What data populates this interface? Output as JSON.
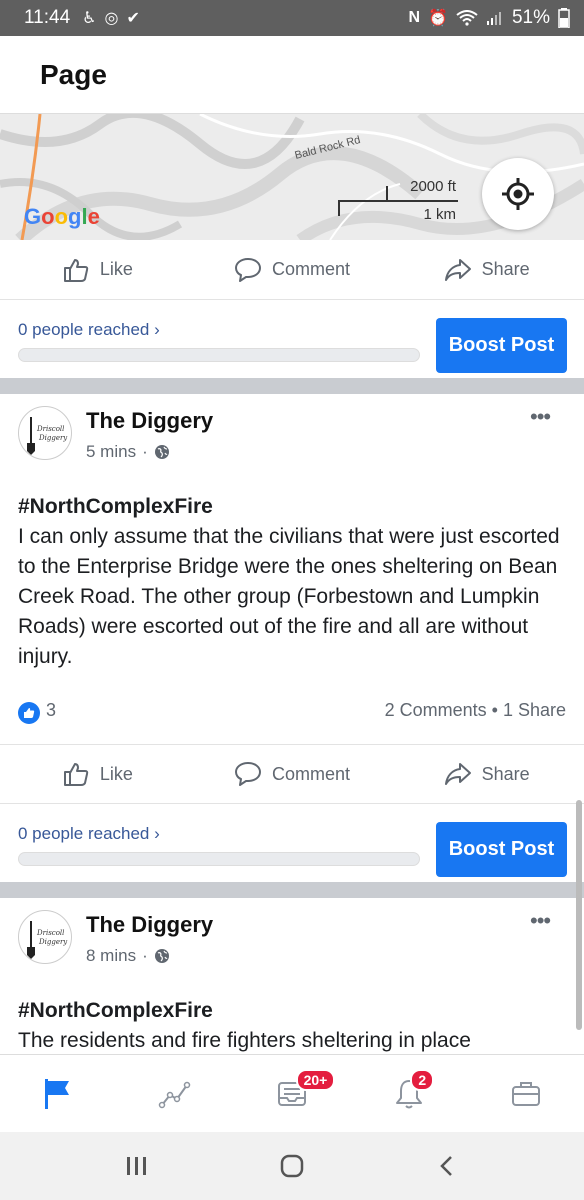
{
  "status_bar": {
    "time": "11:44",
    "battery": "51%"
  },
  "header": {
    "title": "Page"
  },
  "map": {
    "road_label": "Bald Rock Rd",
    "provider": "Google",
    "scale_ft": "2000 ft",
    "scale_km": "1 km"
  },
  "actions": {
    "like": "Like",
    "comment": "Comment",
    "share": "Share"
  },
  "promo": {
    "reach_text": "0 people reached",
    "boost_label": "Boost Post"
  },
  "posts": [
    {
      "page_name": "The Diggery",
      "time": "5 mins",
      "hashtag": "#NorthComplexFire",
      "body": "I can only assume that the civilians that were just escorted to the Enterprise Bridge were the ones sheltering on Bean Creek Road. The other group (Forbestown and Lumpkin Roads) were escorted out of the fire and all are without injury.",
      "likes": "3",
      "comments": "2 Comments",
      "shares": "1 Share"
    },
    {
      "page_name": "The Diggery",
      "time": "8 mins",
      "hashtag": "#NorthComplexFire",
      "body": "The residents and fire fighters sheltering in place"
    }
  ],
  "tabbar": {
    "items": [
      {
        "icon": "flag-icon",
        "active": true
      },
      {
        "icon": "insights-icon",
        "active": false
      },
      {
        "icon": "inbox-icon",
        "badge": "20+"
      },
      {
        "icon": "bell-icon",
        "badge": "2"
      },
      {
        "icon": "briefcase-icon",
        "active": false
      }
    ]
  },
  "colors": {
    "accent": "#1877f2",
    "badge": "#e41e3f",
    "separator": "#c9ccd1"
  }
}
